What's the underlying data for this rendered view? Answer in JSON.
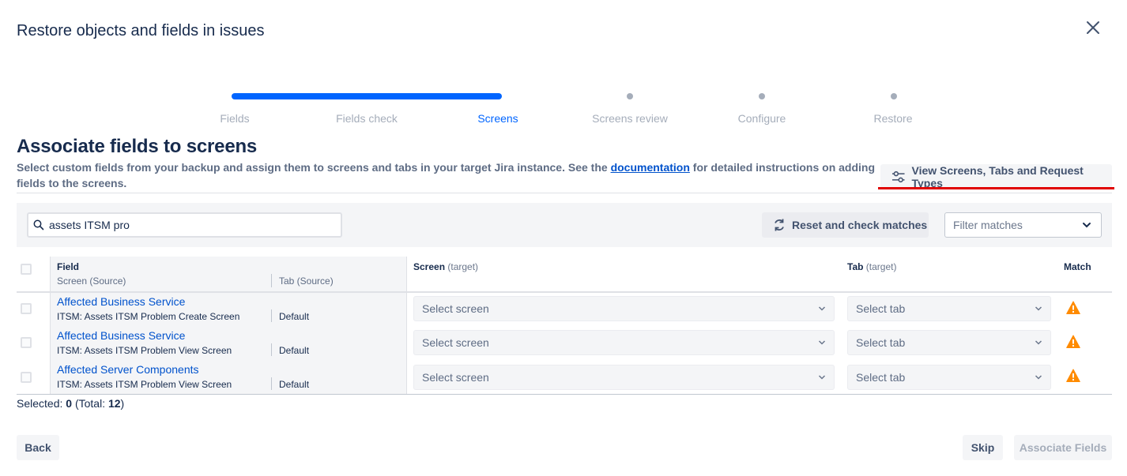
{
  "modal": {
    "title": "Restore objects and fields in issues"
  },
  "steps": [
    {
      "label": "Fields",
      "state": "done"
    },
    {
      "label": "Fields check",
      "state": "done"
    },
    {
      "label": "Screens",
      "state": "active"
    },
    {
      "label": "Screens review",
      "state": "pending"
    },
    {
      "label": "Configure",
      "state": "pending"
    },
    {
      "label": "Restore",
      "state": "pending"
    }
  ],
  "section": {
    "title": "Associate fields to screens",
    "desc_before": "Select custom fields from your backup and assign them to screens and tabs in your target Jira instance. See the ",
    "desc_link": "documentation",
    "desc_after": " for detailed instructions on adding fields to the screens."
  },
  "view_button": {
    "label": "View Screens, Tabs and Request Types",
    "icon": "sliders-icon"
  },
  "filters": {
    "search_value": "assets ITSM pro",
    "reset_label": "Reset and check matches",
    "filter_placeholder": "Filter matches"
  },
  "table": {
    "headers": {
      "field": "Field",
      "screen_source": "Screen (Source)",
      "tab_source": "Tab (Source)",
      "screen_target": "Screen",
      "screen_target_sub": "(target)",
      "tab_target": "Tab",
      "tab_target_sub": "(target)",
      "match": "Match"
    },
    "rows": [
      {
        "field": "Affected Business Service",
        "source_screen": "ITSM: Assets ITSM Problem Create Screen",
        "source_tab": "Default",
        "screen_select": "Select screen",
        "tab_select": "Select tab",
        "match": "warning"
      },
      {
        "field": "Affected Business Service",
        "source_screen": "ITSM: Assets ITSM Problem View Screen",
        "source_tab": "Default",
        "screen_select": "Select screen",
        "tab_select": "Select tab",
        "match": "warning"
      },
      {
        "field": "Affected Server Components",
        "source_screen": "ITSM: Assets ITSM Problem View Screen",
        "source_tab": "Default",
        "screen_select": "Select screen",
        "tab_select": "Select tab",
        "match": "warning"
      }
    ]
  },
  "selection": {
    "selected_label": "Selected:",
    "selected": "0",
    "total_label": "(Total:",
    "total": "12",
    "close_paren": ")"
  },
  "footer": {
    "back": "Back",
    "skip": "Skip",
    "associate": "Associate Fields"
  },
  "colors": {
    "accent": "#0065ff",
    "link": "#0052cc",
    "warning": "#ff8b00",
    "highlight": "#e00000"
  }
}
